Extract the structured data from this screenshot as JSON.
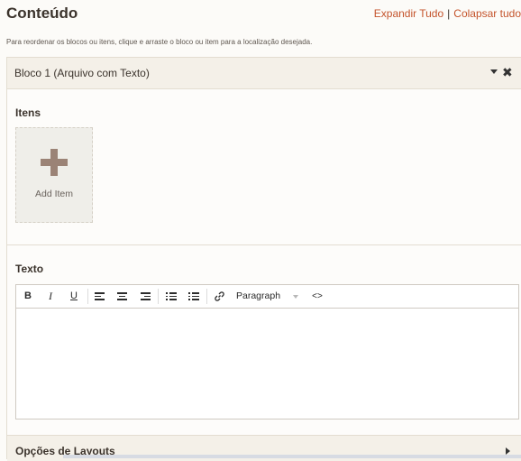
{
  "header": {
    "title": "Conteúdo",
    "expand_all": "Expandir Tudo",
    "separator": "|",
    "collapse_all": "Colapsar tudo"
  },
  "hint": "Para reordenar os blocos ou itens, clique e arraste o bloco ou item para a localização desejada.",
  "block": {
    "title": "Bloco 1 (Arquivo com Texto)",
    "close_glyph": "✖",
    "items_label": "Itens",
    "add_item_label": "Add Item",
    "text_label": "Texto",
    "toolbar": {
      "bold": "B",
      "italic": "I",
      "underline": "U",
      "format_select": "Paragraph",
      "code": "<>"
    },
    "layouts_label": "Opções de Layouts"
  },
  "colors": {
    "accent_link": "#c4532b",
    "plus_icon": "#9b8376",
    "header_bg": "#f4f0e8"
  }
}
